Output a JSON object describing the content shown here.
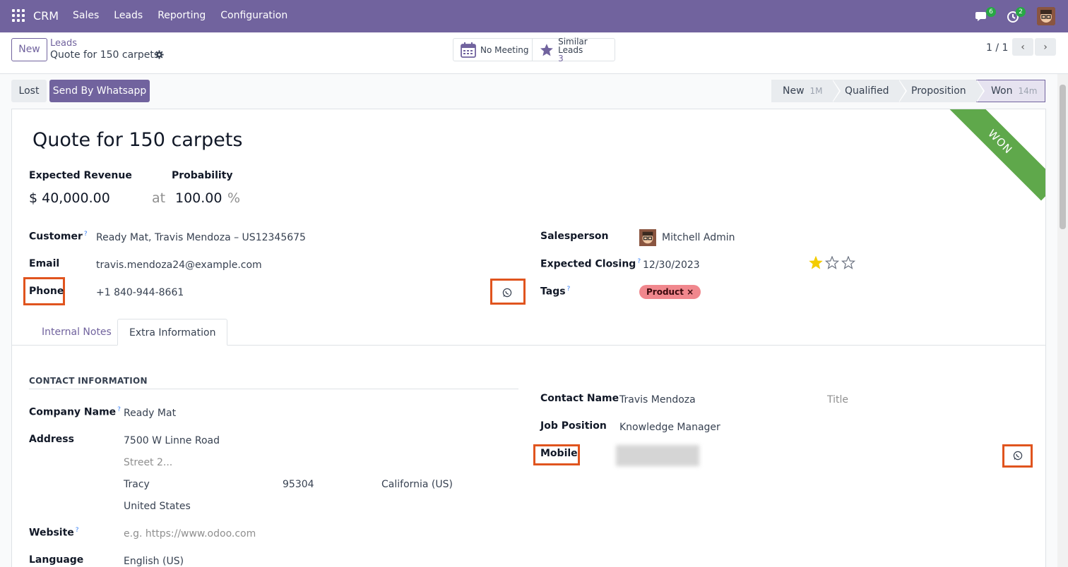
{
  "navbar": {
    "brand": "CRM",
    "menu": [
      "Sales",
      "Leads",
      "Reporting",
      "Configuration"
    ],
    "messages_count": "6",
    "activities_count": "2"
  },
  "control_panel": {
    "new_label": "New",
    "breadcrumb_parent": "Leads",
    "breadcrumb_current": "Quote for 150 carpets",
    "meeting_label": "No Meeting",
    "similar_label": "Similar Leads",
    "similar_count": "3",
    "pager": "1 / 1"
  },
  "statusbar": {
    "lost_label": "Lost",
    "whatsapp_label": "Send By Whatsapp",
    "stages": [
      {
        "name": "New",
        "duration": "1M"
      },
      {
        "name": "Qualified",
        "duration": ""
      },
      {
        "name": "Proposition",
        "duration": ""
      },
      {
        "name": "Won",
        "duration": "14m"
      }
    ]
  },
  "lead": {
    "ribbon": "WON",
    "title": "Quote for 150 carpets",
    "expected_revenue_label": "Expected Revenue",
    "expected_revenue": "$ 40,000.00",
    "at_label": "at",
    "probability_label": "Probability",
    "probability": "100.00",
    "percent": "%",
    "customer_label": "Customer",
    "customer": "Ready Mat, Travis Mendoza – US12345675",
    "email_label": "Email",
    "email": "travis.mendoza24@example.com",
    "phone_label": "Phone",
    "phone": "+1 840-944-8661",
    "salesperson_label": "Salesperson",
    "salesperson": "Mitchell Admin",
    "expected_closing_label": "Expected Closing",
    "expected_closing": "12/30/2023",
    "priority_stars": 1,
    "tags_label": "Tags",
    "tag": "Product"
  },
  "tabs": [
    "Internal Notes",
    "Extra Information"
  ],
  "extra": {
    "section_title": "CONTACT INFORMATION",
    "company_name_label": "Company Name",
    "company_name": "Ready Mat",
    "address_label": "Address",
    "street": "7500 W Linne Road",
    "street2_placeholder": "Street 2...",
    "city": "Tracy",
    "zip": "95304",
    "state": "California (US)",
    "country": "United States",
    "website_label": "Website",
    "website_placeholder": "e.g. https://www.odoo.com",
    "language_label": "Language",
    "language": "English (US)",
    "contact_name_label": "Contact Name",
    "contact_name": "Travis Mendoza",
    "title_placeholder": "Title",
    "job_position_label": "Job Position",
    "job_position": "Knowledge Manager",
    "mobile_label": "Mobile"
  },
  "colors": {
    "brand": "#71639e",
    "won_ribbon": "#5fa84b",
    "highlight": "#e0541e",
    "tag": "#f0878d"
  }
}
